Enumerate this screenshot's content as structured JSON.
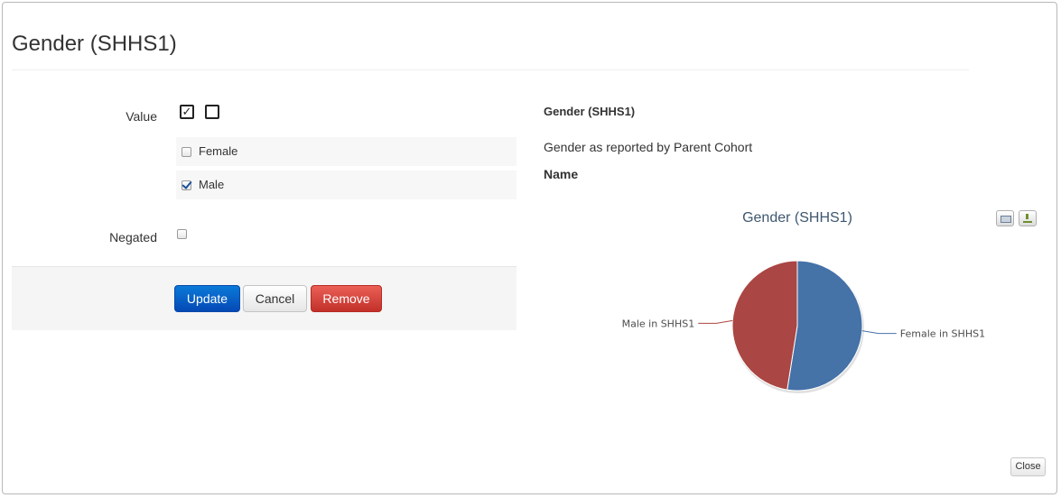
{
  "modal": {
    "title": "Gender (SHHS1)"
  },
  "form": {
    "value_label": "Value",
    "negated_label": "Negated",
    "options": [
      {
        "label": "Female",
        "checked": false
      },
      {
        "label": "Male",
        "checked": true
      }
    ],
    "negated_checked": false,
    "actions": {
      "update": "Update",
      "cancel": "Cancel",
      "remove": "Remove"
    }
  },
  "info": {
    "title": "Gender (SHHS1)",
    "description": "Gender as reported by Parent Cohort",
    "name_heading": "Name"
  },
  "chart_data": {
    "type": "pie",
    "title": "Gender (SHHS1)",
    "slices": [
      {
        "label": "Female in SHHS1",
        "value": 52.5,
        "color": "#4572a7"
      },
      {
        "label": "Male in SHHS1",
        "value": 47.5,
        "color": "#aa4643"
      }
    ],
    "icons": [
      "print-icon",
      "export-icon"
    ]
  },
  "footer": {
    "close": "Close"
  }
}
